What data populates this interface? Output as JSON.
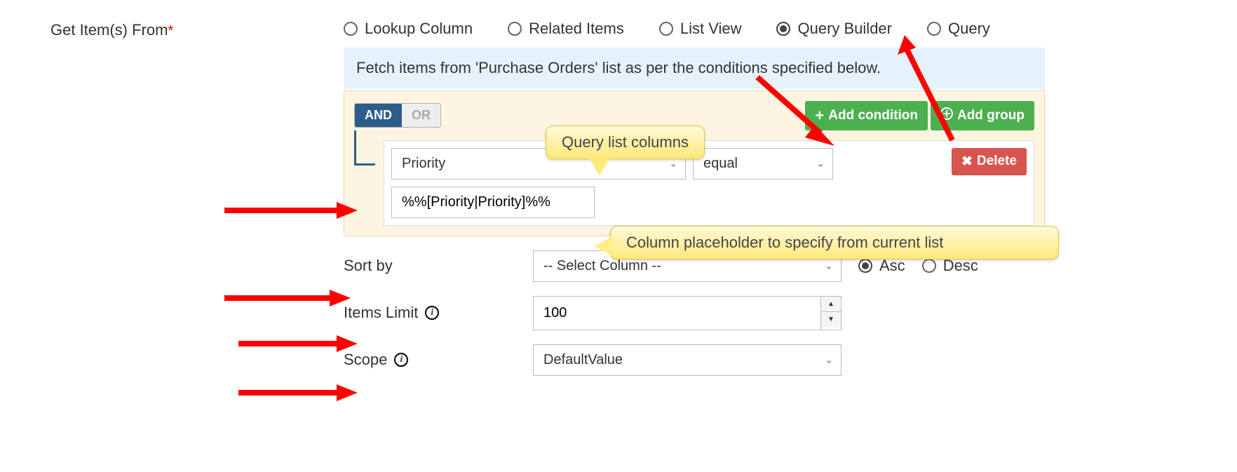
{
  "header": {
    "field_label": "Get Item(s) From",
    "required_mark": "*"
  },
  "radio_options": {
    "lookup": "Lookup Column",
    "related": "Related Items",
    "listview": "List View",
    "querybuilder": "Query Builder",
    "query": "Query",
    "selected": "querybuilder"
  },
  "info_text": "Fetch items from 'Purchase Orders' list as per the conditions specified below.",
  "query_builder": {
    "and_label": "AND",
    "or_label": "OR",
    "add_condition_label": "Add condition",
    "add_group_label": "Add group",
    "delete_label": "Delete",
    "condition": {
      "column": "Priority",
      "operator": "equal",
      "value": "%%[Priority|Priority]%%"
    }
  },
  "callouts": {
    "c1": "Query list columns",
    "c2": "Column placeholder to specify from current list"
  },
  "sort": {
    "label": "Sort by",
    "placeholder": "-- Select Column --",
    "asc": "Asc",
    "desc": "Desc",
    "selected": "asc"
  },
  "items_limit": {
    "label": "Items Limit",
    "value": "100"
  },
  "scope": {
    "label": "Scope",
    "value": "DefaultValue"
  },
  "icons": {
    "plus": "+",
    "circle_plus": "⊕",
    "x": "✖",
    "chevron": "⌄",
    "up": "▲",
    "down": "▼"
  }
}
